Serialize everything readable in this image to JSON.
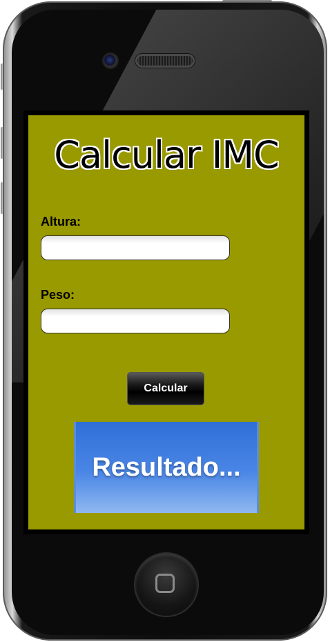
{
  "colors": {
    "app_background": "#999900",
    "result_background": "#4a86e6",
    "button_background": "#000000",
    "button_text": "#ffffff",
    "phone_frame": "#0b0b0b"
  },
  "app": {
    "title": "Calcular IMC",
    "altura_label": "Altura:",
    "altura_value": "",
    "peso_label": "Peso:",
    "peso_value": "",
    "calculate_label": "Calcular",
    "result_text": "Resultado..."
  },
  "device": {
    "icons": {
      "camera": "camera-icon",
      "speaker": "speaker-grille",
      "home": "home-button-icon"
    }
  }
}
